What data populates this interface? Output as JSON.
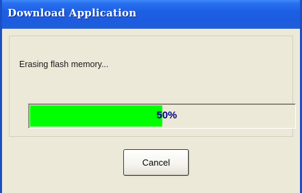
{
  "window": {
    "title": "Download Application"
  },
  "status": {
    "message": "Erasing flash memory..."
  },
  "progress": {
    "fraction": 0.5,
    "label": "50%",
    "color": "#00ff00"
  },
  "buttons": {
    "cancel_label": "Cancel"
  },
  "colors": {
    "titlebar": "#1d5fe3",
    "window_bg": "#ece9d8",
    "progress_text": "#000080"
  }
}
